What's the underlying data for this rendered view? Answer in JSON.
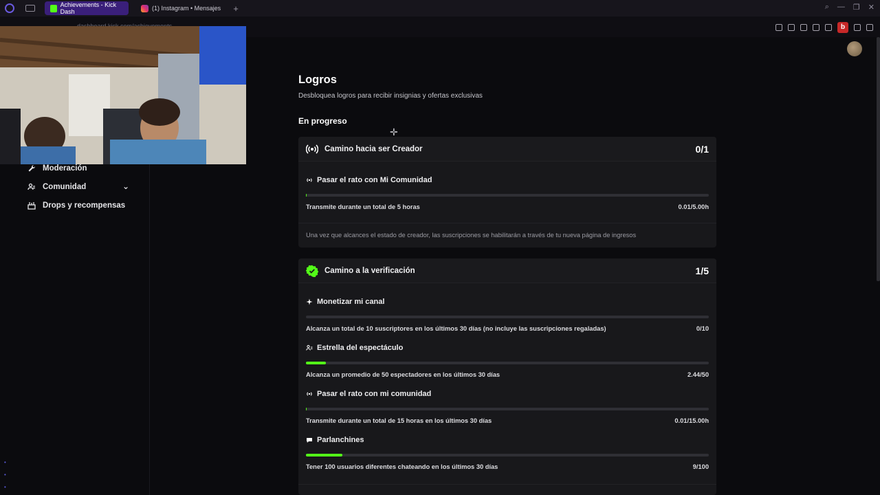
{
  "browser": {
    "tabs": [
      {
        "label": "Achievements - Kick Dash",
        "active": true,
        "favicon": "kick-icon"
      },
      {
        "label": "(1) Instagram • Mensajes",
        "active": false,
        "favicon": "instagram-icon"
      }
    ],
    "url": "dashboard.kick.com/achievements",
    "profile_letter": "b"
  },
  "sidebar": {
    "items": [
      {
        "label": "Moderación",
        "icon": "wrench-icon"
      },
      {
        "label": "Comunidad",
        "icon": "users-icon",
        "expandable": true
      },
      {
        "label": "Drops y recompensas",
        "icon": "gift-icon"
      }
    ]
  },
  "page": {
    "title": "Logros",
    "subtitle": "Desbloquea logros para recibir insignias y ofertas exclusivas",
    "section": "En progreso"
  },
  "cards": [
    {
      "title": "Camino hacia ser Creador",
      "count": "0/1",
      "icon": "broadcast-icon",
      "tasks": [
        {
          "title": "Pasar el rato con Mi Comunidad",
          "icon": "broadcast-icon",
          "desc": "Transmite durante un total de 5 horas",
          "value": "0.01/5.00h",
          "progress": 0.002
        }
      ],
      "footer": "Una vez que alcances el estado de creador, las suscripciones se habilitarán a través de tu nueva página de ingresos"
    },
    {
      "title": "Camino a la verificación",
      "count": "1/5",
      "icon": "verified-badge-icon",
      "tasks": [
        {
          "title": "Monetizar mi canal",
          "icon": "sparkle-icon",
          "desc": "Alcanza un total de 10 suscriptores en los últimos 30 días (no incluye las suscripciones regaladas)",
          "value": "0/10",
          "progress": 0
        },
        {
          "title": "Estrella del espectáculo",
          "icon": "viewers-icon",
          "desc": "Alcanza un promedio de 50 espectadores en los últimos 30 días",
          "value": "2.44/50",
          "progress": 0.0488
        },
        {
          "title": "Pasar el rato con mi comunidad",
          "icon": "broadcast-icon",
          "desc": "Transmite durante un total de 15 horas en los últimos 30 días",
          "value": "0.01/15.00h",
          "progress": 0.001
        },
        {
          "title": "Parlanchines",
          "icon": "chat-icon",
          "desc": "Tener 100 usuarios diferentes chateando en los últimos 30 días",
          "value": "9/100",
          "progress": 0.09
        }
      ]
    }
  ],
  "colors": {
    "accent": "#53fc18",
    "bg": "#0b0b0e",
    "card": "#18181b",
    "track": "#2f2f35"
  }
}
